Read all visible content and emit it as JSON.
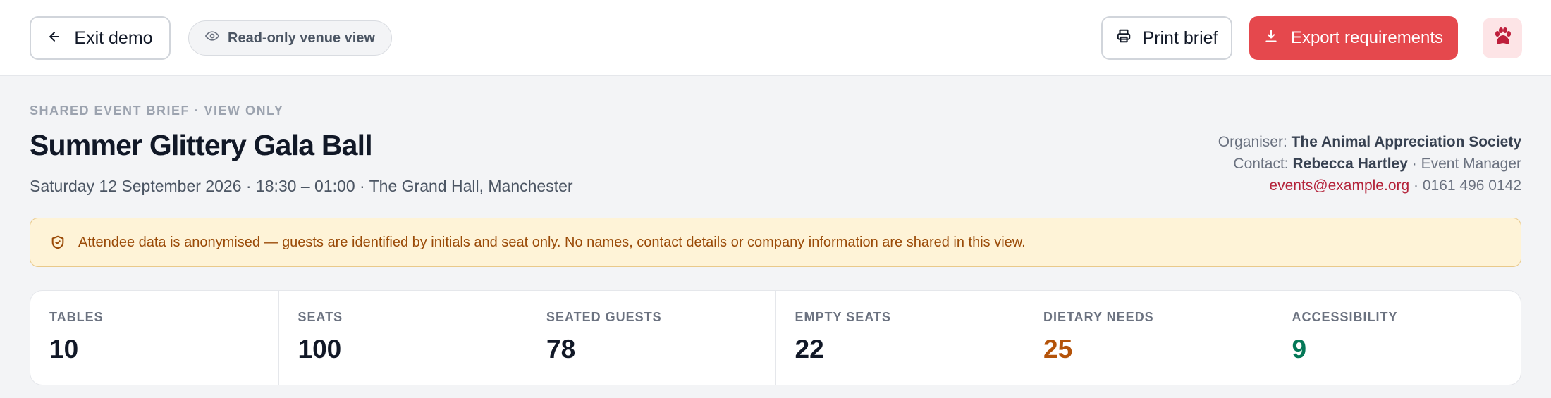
{
  "topbar": {
    "exit_label": "Exit demo",
    "view_badge": "Read-only venue view",
    "print_label": "Print brief",
    "export_label": "Export requirements"
  },
  "header": {
    "eyebrow": "SHARED EVENT BRIEF · VIEW ONLY",
    "title": "Summer Glittery Gala Ball",
    "subtitle": "Saturday 12 September 2026 · 18:30 – 01:00 · The Grand Hall, Manchester"
  },
  "organiser": {
    "organiser_label": "Organiser:",
    "organiser_name": "The Animal Appreciation Society",
    "contact_label": "Contact:",
    "contact_name": "Rebecca Hartley",
    "contact_role": "· Event Manager",
    "email": "events@example.org",
    "phone": "· 0161 496 0142"
  },
  "notice": {
    "text": "Attendee data is anonymised — guests are identified by initials and seat only. No names, contact details or company information are shared in this view."
  },
  "stats": [
    {
      "label": "TABLES",
      "value": "10",
      "color": "#111827"
    },
    {
      "label": "SEATS",
      "value": "100",
      "color": "#111827"
    },
    {
      "label": "SEATED GUESTS",
      "value": "78",
      "color": "#111827"
    },
    {
      "label": "EMPTY SEATS",
      "value": "22",
      "color": "#111827"
    },
    {
      "label": "DIETARY NEEDS",
      "value": "25",
      "color": "#b45309"
    },
    {
      "label": "ACCESSIBILITY",
      "value": "9",
      "color": "#047857"
    }
  ],
  "icons": {
    "exit": "arrow-left-icon",
    "view": "eye-icon",
    "print": "printer-icon",
    "export": "download-icon",
    "avatar": "paw-icon",
    "notice": "shield-check-icon"
  },
  "colors": {
    "accent": "#e5484d",
    "notice_bg": "#fef3d7",
    "notice_text": "#9a4a07",
    "dietary": "#b45309",
    "accessibility": "#047857"
  }
}
